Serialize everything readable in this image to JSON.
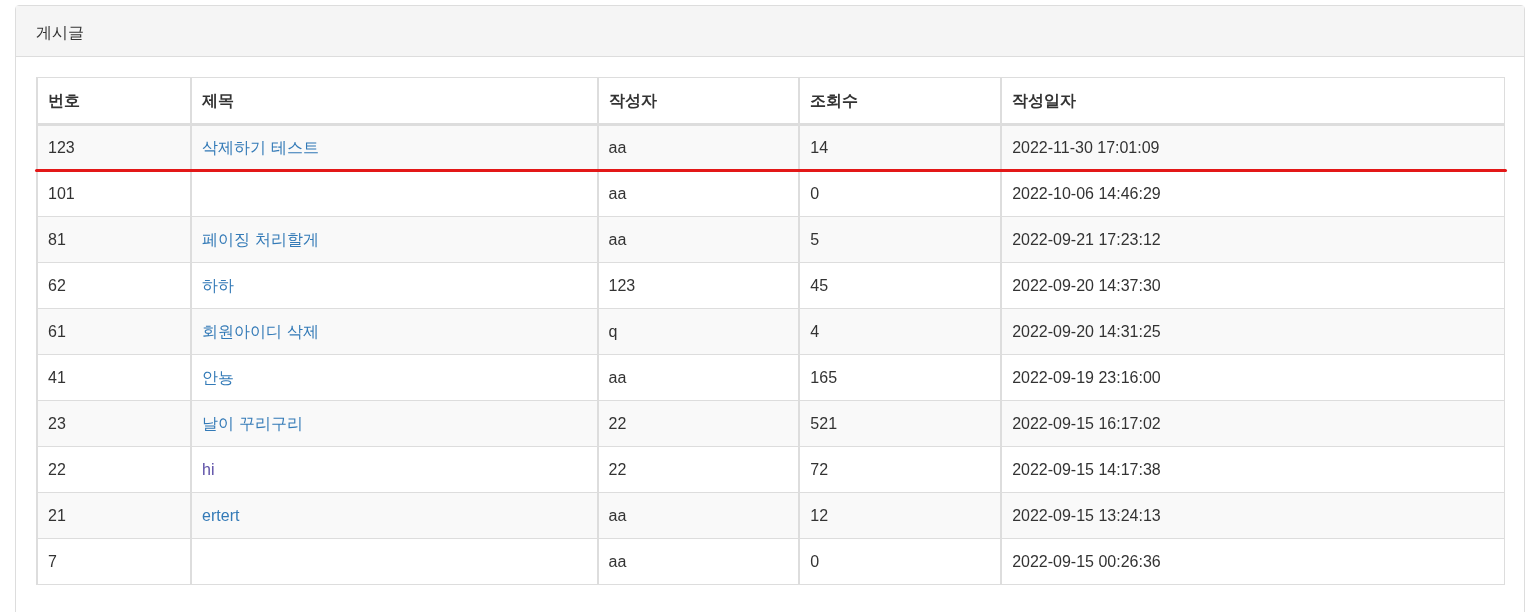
{
  "panel": {
    "title": "게시글"
  },
  "table": {
    "columns": [
      "번호",
      "제목",
      "작성자",
      "조회수",
      "작성일자"
    ],
    "rows": [
      {
        "no": "123",
        "title": "삭제하기 테스트",
        "author": "aa",
        "views": "14",
        "date": "2022-11-30 17:01:09",
        "visited": false,
        "underlined": true
      },
      {
        "no": "101",
        "author": "aa",
        "views": "0",
        "date": "2022-10-06 14:46:29",
        "underlined": false
      },
      {
        "no": "81",
        "title": "페이징 처리할게",
        "author": "aa",
        "views": "5",
        "date": "2022-09-21 17:23:12",
        "visited": false,
        "underlined": false
      },
      {
        "no": "62",
        "title": "하하",
        "author": "123",
        "views": "45",
        "date": "2022-09-20 14:37:30",
        "visited": false,
        "underlined": false
      },
      {
        "no": "61",
        "title": "회원아이디 삭제",
        "author": "q",
        "views": "4",
        "date": "2022-09-20 14:31:25",
        "visited": false,
        "underlined": false
      },
      {
        "no": "41",
        "title": "안뇽",
        "author": "aa",
        "views": "165",
        "date": "2022-09-19 23:16:00",
        "visited": false,
        "underlined": false
      },
      {
        "no": "23",
        "title": "날이 꾸리구리",
        "author": "22",
        "views": "521",
        "date": "2022-09-15 16:17:02",
        "visited": false,
        "underlined": false
      },
      {
        "no": "22",
        "title": "hi",
        "author": "22",
        "views": "72",
        "date": "2022-09-15 14:17:38",
        "visited": true,
        "underlined": false
      },
      {
        "no": "21",
        "title": "ertert",
        "author": "aa",
        "views": "12",
        "date": "2022-09-15 13:24:13",
        "visited": false,
        "underlined": false
      },
      {
        "no": "7",
        "author": "aa",
        "views": "0",
        "date": "2022-09-15 00:26:36",
        "underlined": false
      }
    ]
  }
}
